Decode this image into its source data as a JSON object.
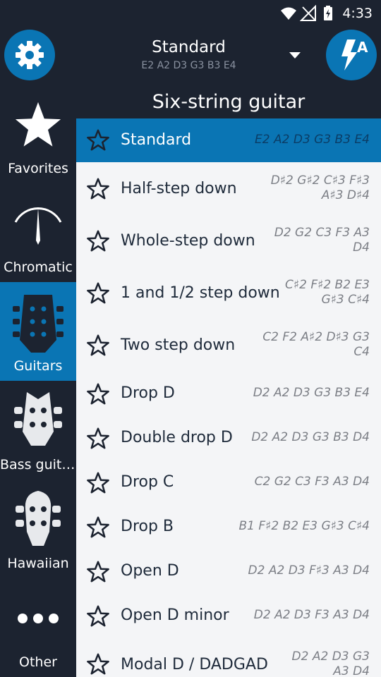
{
  "status": {
    "time": "4:33"
  },
  "topbar": {
    "tuning_name": "Standard",
    "tuning_notes": "E2 A2 D3 G3 B3 E4",
    "auto_letter": "A"
  },
  "sidebar": {
    "items": [
      {
        "label": "Favorites",
        "icon": "star-icon"
      },
      {
        "label": "Chromatic",
        "icon": "needle-gauge-icon"
      },
      {
        "label": "Guitars",
        "icon": "guitar-headstock-icon"
      },
      {
        "label": "Bass guita..",
        "icon": "bass-headstock-icon"
      },
      {
        "label": "Hawaiian",
        "icon": "ukulele-headstock-icon"
      },
      {
        "label": "Other",
        "icon": "more-dots-icon"
      }
    ],
    "active_index": 2
  },
  "section_title": "Six-string guitar",
  "tunings": [
    {
      "name": "Standard",
      "notes_1": "E2 A2 D3 G3 B3 E4",
      "notes_2": ""
    },
    {
      "name": "Half-step down",
      "notes_1": "D♯2 G♯2 C♯3 F♯3",
      "notes_2": "A♯3 D♯4"
    },
    {
      "name": "Whole-step down",
      "notes_1": "D2 G2 C3 F3 A3",
      "notes_2": "D4"
    },
    {
      "name": "1 and 1/2 step down",
      "notes_1": "C♯2 F♯2 B2 E3",
      "notes_2": "G♯3 C♯4"
    },
    {
      "name": "Two step down",
      "notes_1": "C2 F2 A♯2 D♯3 G3",
      "notes_2": "C4"
    },
    {
      "name": "Drop D",
      "notes_1": "D2 A2 D3 G3 B3 E4",
      "notes_2": ""
    },
    {
      "name": "Double drop D",
      "notes_1": "D2 A2 D3 G3 B3 D4",
      "notes_2": ""
    },
    {
      "name": "Drop C",
      "notes_1": "C2 G2 C3 F3 A3 D4",
      "notes_2": ""
    },
    {
      "name": "Drop B",
      "notes_1": "B1 F♯2 B2 E3 G♯3 C♯4",
      "notes_2": ""
    },
    {
      "name": "Open D",
      "notes_1": "D2 A2 D3 F♯3 A3 D4",
      "notes_2": ""
    },
    {
      "name": "Open D minor",
      "notes_1": "D2 A2 D3 F3 A3 D4",
      "notes_2": ""
    },
    {
      "name": "Modal D / DADGAD",
      "notes_1": "D2 A2 D3 G3",
      "notes_2": "A3 D4"
    }
  ],
  "colors": {
    "background": "#1c2330",
    "accent": "#0a75b4",
    "list_bg": "#f4f5f7"
  }
}
